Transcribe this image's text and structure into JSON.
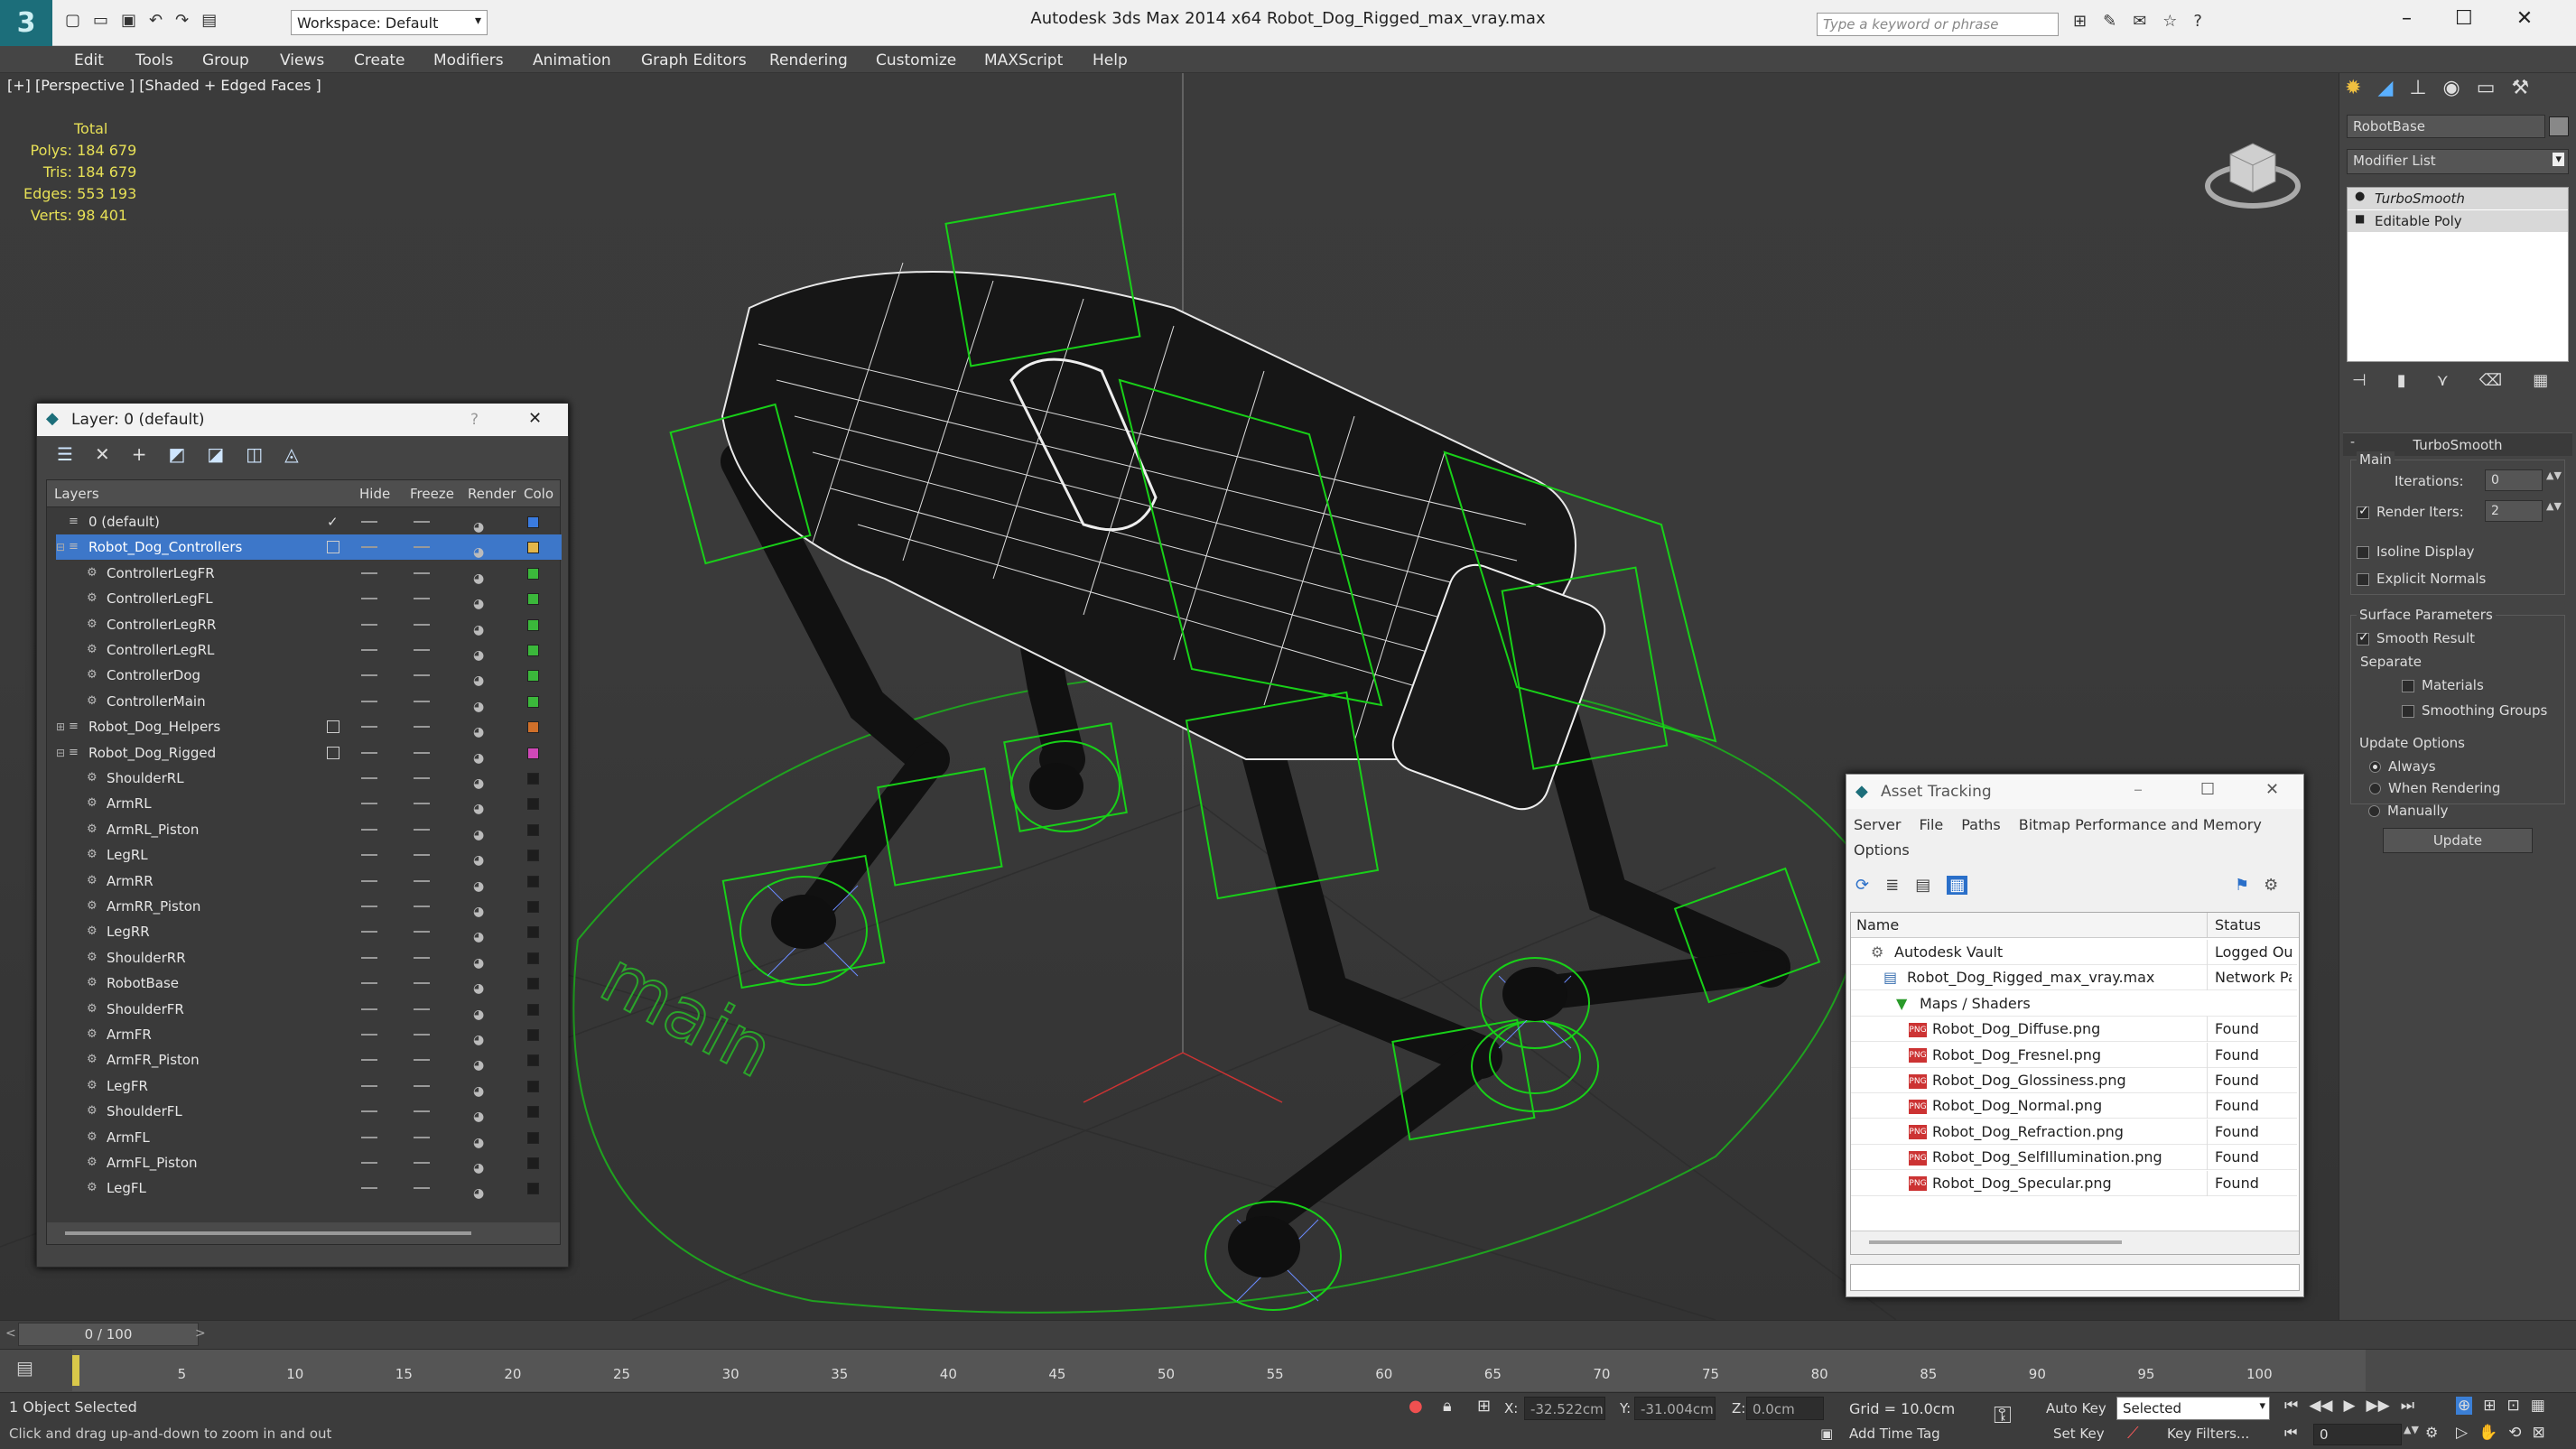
{
  "titlebar": {
    "title": "Autodesk 3ds Max  2014 x64      Robot_Dog_Rigged_max_vray.max",
    "workspace": "Workspace: Default",
    "search_placeholder": "Type a keyword or phrase"
  },
  "menu": [
    "Edit",
    "Tools",
    "Group",
    "Views",
    "Create",
    "Modifiers",
    "Animation",
    "Graph Editors",
    "Rendering",
    "Customize",
    "MAXScript",
    "Help"
  ],
  "viewport": {
    "label": "[+] [Perspective ] [Shaded + Edged Faces ]",
    "stats": {
      "header": "Total",
      "rows": [
        {
          "label": "Polys:",
          "value": "184 679"
        },
        {
          "label": "Tris:",
          "value": "184 679"
        },
        {
          "label": "Edges:",
          "value": "553 193"
        },
        {
          "label": "Verts:",
          "value": "98 401"
        }
      ]
    },
    "ground_text": "main"
  },
  "command_panel": {
    "object_name": "RobotBase",
    "modifier_list": "Modifier List",
    "stack": [
      "TurboSmooth",
      "Editable Poly"
    ],
    "rollout_title": "TurboSmooth",
    "main_label": "Main",
    "iterations_label": "Iterations:",
    "iterations_value": "0",
    "render_iters_label": "Render Iters:",
    "render_iters_value": "2",
    "isoline_label": "Isoline Display",
    "explicit_label": "Explicit Normals",
    "surface_label": "Surface Parameters",
    "smooth_result_label": "Smooth Result",
    "separate_label": "Separate",
    "materials_label": "Materials",
    "smoothing_groups_label": "Smoothing Groups",
    "update_options_label": "Update Options",
    "always_label": "Always",
    "when_rendering_label": "When Rendering",
    "manually_label": "Manually",
    "update_button": "Update"
  },
  "layer_dialog": {
    "title": "Layer: 0 (default)",
    "help": "?",
    "columns": {
      "layers": "Layers",
      "hide": "Hide",
      "freeze": "Freeze",
      "render": "Render",
      "color": "Colo"
    },
    "rows": [
      {
        "name": "0 (default)",
        "level": 1,
        "type": "layer",
        "current": true,
        "color": "#3a7be0"
      },
      {
        "name": "Robot_Dog_Controllers",
        "level": 1,
        "type": "layer",
        "expander": "-",
        "selected": true,
        "color": "#e3b64a"
      },
      {
        "name": "ControllerLegFR",
        "level": 2,
        "type": "obj",
        "color": "#3bb83b"
      },
      {
        "name": "ControllerLegFL",
        "level": 2,
        "type": "obj",
        "color": "#3bb83b"
      },
      {
        "name": "ControllerLegRR",
        "level": 2,
        "type": "obj",
        "color": "#3bb83b"
      },
      {
        "name": "ControllerLegRL",
        "level": 2,
        "type": "obj",
        "color": "#3bb83b"
      },
      {
        "name": "ControllerDog",
        "level": 2,
        "type": "obj",
        "color": "#3bb83b"
      },
      {
        "name": "ControllerMain",
        "level": 2,
        "type": "obj",
        "color": "#3bb83b"
      },
      {
        "name": "Robot_Dog_Helpers",
        "level": 1,
        "type": "layer",
        "expander": "+",
        "color": "#d0702a"
      },
      {
        "name": "Robot_Dog_Rigged",
        "level": 1,
        "type": "layer",
        "expander": "-",
        "color": "#d048b8"
      },
      {
        "name": "ShoulderRL",
        "level": 2,
        "type": "obj",
        "color": "#1d1d1d"
      },
      {
        "name": "ArmRL",
        "level": 2,
        "type": "obj",
        "color": "#1d1d1d"
      },
      {
        "name": "ArmRL_Piston",
        "level": 2,
        "type": "obj",
        "color": "#1d1d1d"
      },
      {
        "name": "LegRL",
        "level": 2,
        "type": "obj",
        "color": "#1d1d1d"
      },
      {
        "name": "ArmRR",
        "level": 2,
        "type": "obj",
        "color": "#1d1d1d"
      },
      {
        "name": "ArmRR_Piston",
        "level": 2,
        "type": "obj",
        "color": "#1d1d1d"
      },
      {
        "name": "LegRR",
        "level": 2,
        "type": "obj",
        "color": "#1d1d1d"
      },
      {
        "name": "ShoulderRR",
        "level": 2,
        "type": "obj",
        "color": "#1d1d1d"
      },
      {
        "name": "RobotBase",
        "level": 2,
        "type": "obj",
        "color": "#1d1d1d"
      },
      {
        "name": "ShoulderFR",
        "level": 2,
        "type": "obj",
        "color": "#1d1d1d"
      },
      {
        "name": "ArmFR",
        "level": 2,
        "type": "obj",
        "color": "#1d1d1d"
      },
      {
        "name": "ArmFR_Piston",
        "level": 2,
        "type": "obj",
        "color": "#1d1d1d"
      },
      {
        "name": "LegFR",
        "level": 2,
        "type": "obj",
        "color": "#1d1d1d"
      },
      {
        "name": "ShoulderFL",
        "level": 2,
        "type": "obj",
        "color": "#1d1d1d"
      },
      {
        "name": "ArmFL",
        "level": 2,
        "type": "obj",
        "color": "#1d1d1d"
      },
      {
        "name": "ArmFL_Piston",
        "level": 2,
        "type": "obj",
        "color": "#1d1d1d"
      },
      {
        "name": "LegFL",
        "level": 2,
        "type": "obj",
        "color": "#1d1d1d"
      }
    ]
  },
  "asset_tracking": {
    "title": "Asset Tracking",
    "menu": [
      "Server",
      "File",
      "Paths",
      "Bitmap Performance and Memory"
    ],
    "menu2": "Options",
    "columns": {
      "name": "Name",
      "status": "Status"
    },
    "rows": [
      {
        "name": "Autodesk Vault",
        "status": "Logged Out",
        "indent": 1,
        "kind": "vault"
      },
      {
        "name": "Robot_Dog_Rigged_max_vray.max",
        "status": "Network Pa",
        "indent": 2,
        "kind": "max"
      },
      {
        "name": "Maps / Shaders",
        "status": "",
        "indent": 3,
        "kind": "folder"
      },
      {
        "name": "Robot_Dog_Diffuse.png",
        "status": "Found",
        "indent": 4,
        "kind": "png"
      },
      {
        "name": "Robot_Dog_Fresnel.png",
        "status": "Found",
        "indent": 4,
        "kind": "png"
      },
      {
        "name": "Robot_Dog_Glossiness.png",
        "status": "Found",
        "indent": 4,
        "kind": "png"
      },
      {
        "name": "Robot_Dog_Normal.png",
        "status": "Found",
        "indent": 4,
        "kind": "png"
      },
      {
        "name": "Robot_Dog_Refraction.png",
        "status": "Found",
        "indent": 4,
        "kind": "png"
      },
      {
        "name": "Robot_Dog_SelfIllumination.png",
        "status": "Found",
        "indent": 4,
        "kind": "png"
      },
      {
        "name": "Robot_Dog_Specular.png",
        "status": "Found",
        "indent": 4,
        "kind": "png"
      }
    ]
  },
  "timeline": {
    "frame": "0 / 100",
    "ticks": [
      "5",
      "10",
      "15",
      "20",
      "25",
      "30",
      "35",
      "40",
      "45",
      "50",
      "55",
      "60",
      "65",
      "70",
      "75",
      "80",
      "85",
      "90",
      "95",
      "100"
    ]
  },
  "status": {
    "selected": "1 Object Selected",
    "prompt": "Click and drag up-and-down to zoom in and out",
    "x_label": "X:",
    "x_value": "-32.522cm",
    "y_label": "Y:",
    "y_value": "-31.004cm",
    "z_label": "Z:",
    "z_value": "0.0cm",
    "grid": "Grid = 10.0cm",
    "add_time_tag": "Add Time Tag",
    "auto_key": "Auto Key",
    "set_key": "Set Key",
    "selected_dropdown": "Selected",
    "key_filters": "Key Filters...",
    "frame_value": "0"
  }
}
